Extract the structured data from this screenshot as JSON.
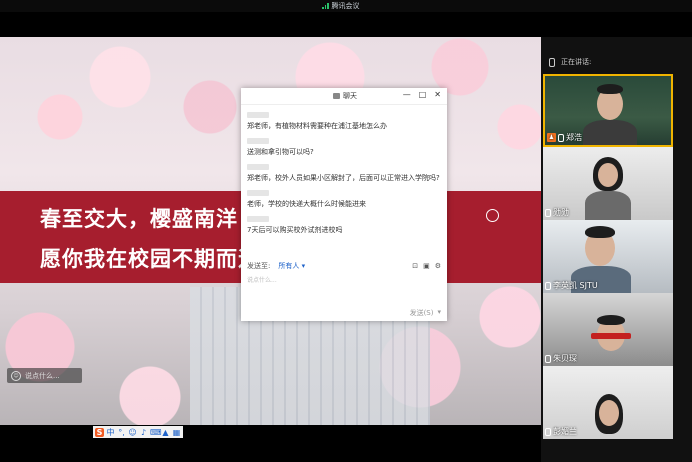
{
  "app": {
    "title": "腾讯会议",
    "accent": "#29c36a"
  },
  "slide": {
    "line1": "春至交大，樱盛南洋",
    "line2": "愿你我在校园不期而遇，岁月坚毅",
    "banner_color": "#a61e2e"
  },
  "chat_hint": "说点什么...",
  "chat": {
    "title": "聊天",
    "messages": [
      {
        "text": "郑老师，有植物材料需要种在浦江基地怎么办"
      },
      {
        "text": "送测和拿引物可以吗?"
      },
      {
        "text": "郑老师，校外人员如果小区解封了，后面可以正常进入学院吗?"
      },
      {
        "text": "老师，学校的快递大概什么时候能进来"
      },
      {
        "text": "7天后可以购买校外试剂进校吗"
      }
    ],
    "send_to_label": "发送至:",
    "send_to_value": "所有人",
    "input_placeholder": "说点什么...",
    "send_button": "发送(S)"
  },
  "participants": {
    "speaking_label": "正在讲话:",
    "list": [
      {
        "name": "郑浩",
        "host": true
      },
      {
        "name": "勋勋"
      },
      {
        "name": "李英凯 SJTU"
      },
      {
        "name": "朱贝琛"
      },
      {
        "name": "彭媚兰"
      }
    ]
  },
  "ime": {
    "logo": "S",
    "mode": "中"
  }
}
